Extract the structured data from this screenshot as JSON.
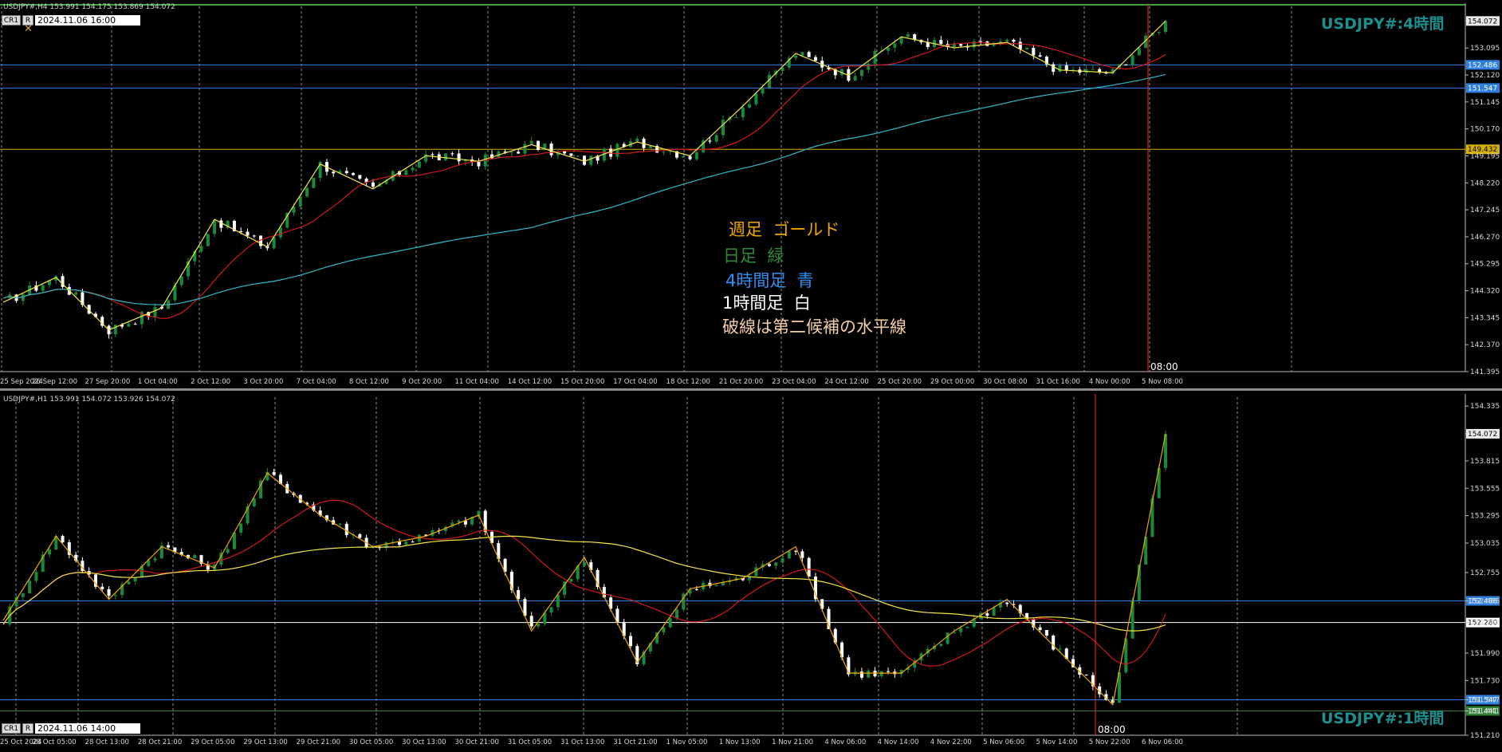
{
  "charts": [
    {
      "symbol_line": "USDJPY#,H4  153.991 154.175 153.869 154.072",
      "title_corner": "USDJPY#:4時間",
      "selector_cr": "CR1",
      "selector_r": "R",
      "selector_date": "2024.11.06 16:00",
      "vline_label": "08:00",
      "price_ticks": [
        "154.072",
        "153.095",
        "152.120",
        "151.145",
        "150.170",
        "149.195",
        "148.220",
        "147.245",
        "146.270",
        "145.295",
        "144.320",
        "143.345",
        "142.370",
        "141.395"
      ],
      "time_labels": [
        "25 Sep 2024",
        "26 Sep 12:00",
        "27 Sep 20:00",
        "1 Oct 04:00",
        "2 Oct 12:00",
        "3 Oct 20:00",
        "7 Oct 04:00",
        "8 Oct 12:00",
        "9 Oct 20:00",
        "11 Oct 04:00",
        "14 Oct 12:00",
        "15 Oct 20:00",
        "17 Oct 04:00",
        "18 Oct 12:00",
        "21 Oct 20:00",
        "23 Oct 04:00",
        "24 Oct 12:00",
        "25 Oct 20:00",
        "29 Oct 00:00",
        "30 Oct 08:00",
        "31 Oct 16:00",
        "4 Nov 00:00",
        "5 Nov 08:00"
      ],
      "hlines": [
        {
          "price": 152.486,
          "label": "152.486",
          "color": "#2f7fe0"
        },
        {
          "price": 151.647,
          "label": "151.547",
          "color": "#2f7fe0"
        },
        {
          "price": 149.432,
          "label": "149.432",
          "color": "#d4b000"
        }
      ],
      "current_price": "154.072"
    },
    {
      "symbol_line": "USDJPY#,H1  153.991 154.072 153.926 154.072",
      "title_corner": "USDJPY#:1時間",
      "selector_cr": "CR1",
      "selector_r": "R",
      "selector_date": "2024.11.06 14:00",
      "vline_label": "08:00",
      "price_ticks": [
        "154.335",
        "154.072",
        "153.815",
        "153.555",
        "153.295",
        "153.035",
        "152.755",
        "152.486",
        "152.280",
        "151.990",
        "151.730",
        "151.547",
        "151.441",
        "151.210"
      ],
      "time_labels": [
        "25 Oct 2024",
        "28 Oct 05:00",
        "28 Oct 13:00",
        "28 Oct 21:00",
        "29 Oct 05:00",
        "29 Oct 13:00",
        "29 Oct 21:00",
        "30 Oct 05:00",
        "30 Oct 13:00",
        "30 Oct 21:00",
        "31 Oct 05:00",
        "31 Oct 13:00",
        "31 Oct 21:00",
        "1 Nov 05:00",
        "1 Nov 13:00",
        "1 Nov 21:00",
        "4 Nov 06:00",
        "4 Nov 14:00",
        "4 Nov 22:00",
        "5 Nov 06:00",
        "5 Nov 14:00",
        "5 Nov 22:00",
        "6 Nov 06:00"
      ],
      "hlines": [
        {
          "price": 152.486,
          "label": "152.486",
          "color": "#2f7fe0"
        },
        {
          "price": 152.28,
          "label": "152.280",
          "color": "#ffffff"
        },
        {
          "price": 151.547,
          "label": "151.547",
          "color": "#2f7fe0"
        },
        {
          "price": 151.441,
          "label": "151.441",
          "color": "#2e7d32"
        }
      ],
      "current_price": "154.072"
    }
  ],
  "legend": {
    "weekly": "週足  ゴールド",
    "daily": "日足  緑",
    "h4": "4時間足  青",
    "h1": "1時間足  白",
    "dashed": "破線は第二候補の水平線"
  },
  "colors": {
    "bull": "#1a8a3a",
    "bear": "#ffffff",
    "ma_red": "#d11a1a",
    "ma_cyan": "#30b8c8",
    "ma_yellow": "#f2e34a",
    "zigzag": "#f0a500",
    "weekly_text": "#f0a500",
    "daily_text": "#2e8b3a",
    "h4_text": "#2f8ff0",
    "h1_text": "#ffffff",
    "dashed_text": "#f4cda6",
    "brand": "#1d8f8f"
  },
  "chart_data": [
    {
      "type": "line",
      "title": "USDJPY#:4時間",
      "xlabel": "",
      "ylabel": "",
      "x": [
        "25 Sep 2024",
        "26 Sep 12:00",
        "27 Sep 20:00",
        "1 Oct 04:00",
        "2 Oct 12:00",
        "3 Oct 20:00",
        "7 Oct 04:00",
        "8 Oct 12:00",
        "9 Oct 20:00",
        "11 Oct 04:00",
        "14 Oct 12:00",
        "15 Oct 20:00",
        "17 Oct 04:00",
        "18 Oct 12:00",
        "21 Oct 20:00",
        "23 Oct 04:00",
        "24 Oct 12:00",
        "25 Oct 20:00",
        "29 Oct 00:00",
        "30 Oct 08:00",
        "31 Oct 16:00",
        "4 Nov 00:00",
        "5 Nov 08:00"
      ],
      "series": [
        {
          "values": [
            143.9,
            144.8,
            142.9,
            143.7,
            146.9,
            145.9,
            148.9,
            148.0,
            149.2,
            149.0,
            149.6,
            149.0,
            149.7,
            149.2,
            151.0,
            152.9,
            152.1,
            153.5,
            153.1,
            153.3,
            152.3,
            152.2,
            154.07
          ]
        }
      ],
      "ylim": [
        141.395,
        154.6
      ],
      "grid": true
    },
    {
      "type": "line",
      "title": "USDJPY#:1時間",
      "xlabel": "",
      "ylabel": "",
      "x": [
        "25 Oct 2024",
        "28 Oct 05:00",
        "28 Oct 13:00",
        "28 Oct 21:00",
        "29 Oct 05:00",
        "29 Oct 13:00",
        "29 Oct 21:00",
        "30 Oct 05:00",
        "30 Oct 13:00",
        "30 Oct 21:00",
        "31 Oct 05:00",
        "31 Oct 13:00",
        "31 Oct 21:00",
        "1 Nov 05:00",
        "1 Nov 13:00",
        "1 Nov 21:00",
        "4 Nov 06:00",
        "4 Nov 14:00",
        "4 Nov 22:00",
        "5 Nov 06:00",
        "5 Nov 14:00",
        "5 Nov 22:00",
        "6 Nov 06:00"
      ],
      "series": [
        {
          "values": [
            152.3,
            153.1,
            152.5,
            153.0,
            152.8,
            153.7,
            153.3,
            153.0,
            153.1,
            153.3,
            152.2,
            152.9,
            151.9,
            152.6,
            152.7,
            153.0,
            151.8,
            151.8,
            152.2,
            152.5,
            152.0,
            151.5,
            154.07
          ]
        }
      ],
      "ylim": [
        151.21,
        154.42
      ],
      "grid": true
    }
  ]
}
